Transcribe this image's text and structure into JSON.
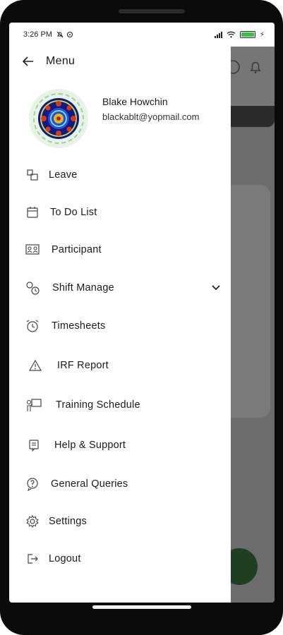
{
  "status_bar": {
    "time": "3:26 PM"
  },
  "header": {
    "title": "Menu"
  },
  "profile": {
    "name": "Blake Howchin",
    "email": "blackablt@yopmail.com"
  },
  "menu": {
    "items": [
      {
        "label": "Leave",
        "icon": "leave-icon"
      },
      {
        "label": "To Do List",
        "icon": "calendar-icon"
      },
      {
        "label": "Participant",
        "icon": "participant-icon"
      },
      {
        "label": "Shift Manage",
        "icon": "shift-icon"
      },
      {
        "label": "Timesheets",
        "icon": "alarm-clock-icon"
      },
      {
        "label": "IRF Report",
        "icon": "warning-icon"
      },
      {
        "label": "Training Schedule",
        "icon": "training-icon"
      },
      {
        "label": "Help & Support",
        "icon": "help-icon"
      },
      {
        "label": "General Queries",
        "icon": "queries-icon"
      },
      {
        "label": "Settings",
        "icon": "settings-icon"
      },
      {
        "label": "Logout",
        "icon": "logout-icon"
      }
    ]
  },
  "colors": {
    "accent": "#1f3f22",
    "battery": "#3fbf3f",
    "overlay": "#6f6f6f"
  }
}
